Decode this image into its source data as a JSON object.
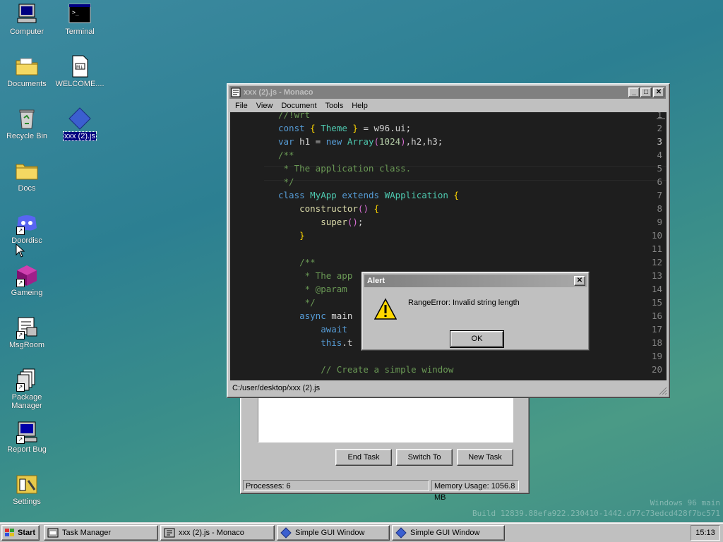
{
  "desktop_icons": [
    {
      "label": "Computer",
      "icon": "computer-icon"
    },
    {
      "label": "Terminal",
      "icon": "terminal-icon"
    },
    {
      "label": "Documents",
      "icon": "folder-documents-icon"
    },
    {
      "label": "WELCOME....",
      "icon": "markdown-file-icon"
    },
    {
      "label": "Recycle Bin",
      "icon": "recycle-bin-icon"
    },
    {
      "label": "xxx (2).js",
      "icon": "js-file-icon"
    },
    {
      "label": "Docs",
      "icon": "folder-icon"
    },
    {
      "label": "Doordisc",
      "icon": "discord-icon"
    },
    {
      "label": "Gameing",
      "icon": "cube-icon"
    },
    {
      "label": "MsgRoom",
      "icon": "msgroom-icon"
    },
    {
      "label": "Package Manager",
      "icon": "package-icon"
    },
    {
      "label": "Report Bug",
      "icon": "report-bug-icon"
    },
    {
      "label": "Settings",
      "icon": "settings-icon"
    }
  ],
  "editor_window": {
    "title": "xxx (2).js - Monaco",
    "menu": [
      "File",
      "View",
      "Document",
      "Tools",
      "Help"
    ],
    "line_numbers": [
      "1",
      "2",
      "3",
      "4",
      "5",
      "6",
      "7",
      "8",
      "9",
      "10",
      "11",
      "12",
      "13",
      "14",
      "15",
      "16",
      "17",
      "18",
      "19",
      "20"
    ],
    "code_lines": [
      "//!wrt",
      "const { Theme } = w96.ui;",
      "var h1 = new Array(1024),h2,h3;",
      "/**",
      " * The application class.",
      " */",
      "class MyApp extends WApplication {",
      "    constructor() {",
      "        super();",
      "    }",
      "",
      "    /**",
      "     * The app",
      "     * @param",
      "     */",
      "    async main",
      "        await",
      "        this.t",
      "",
      "        // Create a simple window"
    ],
    "status_path": "C:/user/desktop/xxx (2).js"
  },
  "alert_dialog": {
    "title": "Alert",
    "message": "RangeError: Invalid string length",
    "ok_label": "OK"
  },
  "task_manager": {
    "end_task": "End Task",
    "switch_to": "Switch To",
    "new_task": "New Task",
    "processes": "Processes: 6",
    "memory": "Memory Usage: 1056.8 MB"
  },
  "taskbar": {
    "start_label": "Start",
    "items": [
      "Task Manager",
      "xxx (2).js - Monaco",
      "Simple GUI Window",
      "Simple GUI Window"
    ],
    "clock": "15:13"
  },
  "watermark": {
    "line1": "Windows 96 main",
    "line2": "Build 12839.88efa922.230410-1442.d77c73edcd428f7bc571"
  },
  "colors": {
    "title_active": "#000080",
    "desktop": "#2c7f92",
    "editor_bg": "#1e1e1e"
  }
}
